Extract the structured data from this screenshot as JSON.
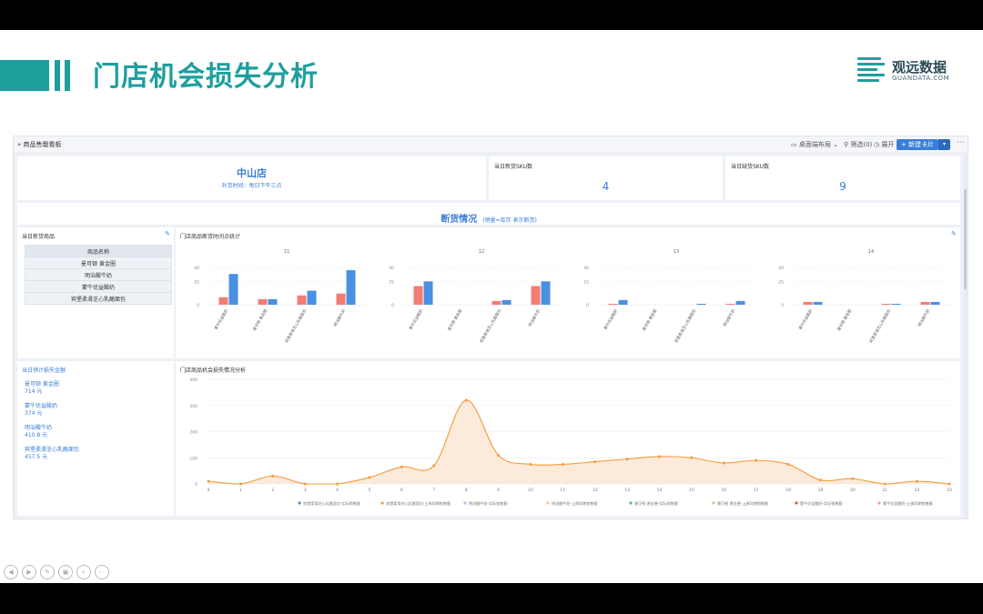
{
  "slide": {
    "title": "门店机会损失分析",
    "logo": {
      "name": "观远数据",
      "sub": "GUANDATA.COM"
    }
  },
  "toolbar": {
    "board_name": "商品售罄看板",
    "display_mode": "桌面端布局",
    "filter": "筛选(0)",
    "expand": "展开",
    "new_card": "新建卡片"
  },
  "kpi": {
    "store": "中山店",
    "restock_time": "补货时间：每日下午三点",
    "new_sku_label": "当日新货SKU数",
    "new_sku_value": "4",
    "missing_sku_label": "当日缺货SKU数",
    "missing_sku_value": "9"
  },
  "section": {
    "title": "断货情况",
    "subtitle": "(销量=库存 表示断货)"
  },
  "new_products": {
    "title": "当日新货商品",
    "header": "商品名称",
    "rows": [
      "曼可顿 黄金圈",
      "明治酸牛奶",
      "蒙牛优益酸奶",
      "宾堡柔滑芝心乳酪面包"
    ]
  },
  "loss": {
    "title": "当日预计损失金额",
    "items": [
      {
        "name": "曼可顿 黄金圈",
        "value": "714 元"
      },
      {
        "name": "蒙牛优益酸奶",
        "value": "374 元"
      },
      {
        "name": "明治酸牛奶",
        "value": "410.8 元"
      },
      {
        "name": "宾堡柔滑芝心乳酪面包",
        "value": "457.5 元"
      }
    ]
  },
  "stock_chart_title": "门店商品断货时间点统计",
  "loss_chart_title": "门店商品机会损失情况分析",
  "colors": {
    "accent": "#3b7dd8",
    "teal": "#1f9e9e",
    "bar_red": "#f47c74",
    "bar_blue": "#4a90e2",
    "line": "#f39c3c"
  },
  "chart_data": [
    {
      "type": "bar",
      "title": "11",
      "categories": [
        "蒙牛优益酸奶",
        "曼可顿 黄金圈",
        "宾堡柔滑芝心乳酪面包",
        "明治酸牛奶"
      ],
      "series": [
        {
          "values": [
            8,
            6,
            10,
            12
          ]
        },
        {
          "values": [
            33,
            6,
            15,
            37
          ]
        }
      ],
      "yticks": [
        0,
        25,
        40
      ],
      "ylim": [
        0,
        40
      ]
    },
    {
      "type": "bar",
      "title": "12",
      "categories": [
        "蒙牛优益酸奶",
        "曼可顿 黄金圈",
        "宾堡柔滑芝心乳酪面包",
        "明治酸牛奶"
      ],
      "series": [
        {
          "values": [
            20,
            0,
            4,
            20
          ]
        },
        {
          "values": [
            25,
            0,
            5,
            25
          ]
        }
      ],
      "yticks": [
        0,
        25,
        40
      ],
      "ylim": [
        0,
        40
      ]
    },
    {
      "type": "bar",
      "title": "13",
      "categories": [
        "蒙牛优益酸奶",
        "曼可顿 黄金圈",
        "宾堡柔滑芝心乳酪面包",
        "明治酸牛奶"
      ],
      "series": [
        {
          "values": [
            1,
            0,
            0,
            1
          ]
        },
        {
          "values": [
            5,
            0,
            1,
            4
          ]
        }
      ],
      "yticks": [
        0,
        25,
        40
      ],
      "ylim": [
        0,
        40
      ]
    },
    {
      "type": "bar",
      "title": "14",
      "categories": [
        "蒙牛优益酸奶",
        "曼可顿 黄金圈",
        "宾堡柔滑芝心乳酪面包",
        "明治酸牛奶"
      ],
      "series": [
        {
          "values": [
            3,
            0,
            1,
            3
          ]
        },
        {
          "values": [
            3,
            0,
            1,
            3
          ]
        }
      ],
      "yticks": [
        0,
        25,
        40
      ],
      "ylim": [
        0,
        40
      ]
    },
    {
      "type": "area",
      "x": [
        0,
        1,
        2,
        3,
        4,
        5,
        6,
        7,
        8,
        9,
        10,
        11,
        12,
        13,
        14,
        15,
        16,
        17,
        18,
        19,
        20,
        21,
        22,
        23
      ],
      "y": [
        10,
        0,
        30,
        0,
        0,
        25,
        65,
        70,
        320,
        110,
        75,
        75,
        85,
        95,
        105,
        100,
        80,
        90,
        75,
        15,
        20,
        0,
        10,
        0
      ],
      "ylim": [
        0,
        400
      ],
      "yticks": [
        0,
        100,
        200,
        300,
        400
      ],
      "legend": [
        {
          "name": "宾堡柔滑芝心乳酪面包-实际销售额",
          "color": "#4a90e2"
        },
        {
          "name": "宾堡柔滑芝心乳酪面包-上周同期销售额",
          "color": "#f39c3c"
        },
        {
          "name": "明治酸牛奶-实际销售额",
          "color": "#a9c9ef"
        },
        {
          "name": "明治酸牛奶-上周同期销售额",
          "color": "#f7c98c"
        },
        {
          "name": "曼可顿 黄金圈-实际销售额",
          "color": "#5cb88a"
        },
        {
          "name": "曼可顿 黄金圈-上周同期销售额",
          "color": "#a8d88f"
        },
        {
          "name": "蒙牛优益酸奶-实际销售额",
          "color": "#e8524a"
        },
        {
          "name": "蒙牛优益酸奶-上周同期销售额",
          "color": "#f4a19c"
        }
      ]
    }
  ]
}
